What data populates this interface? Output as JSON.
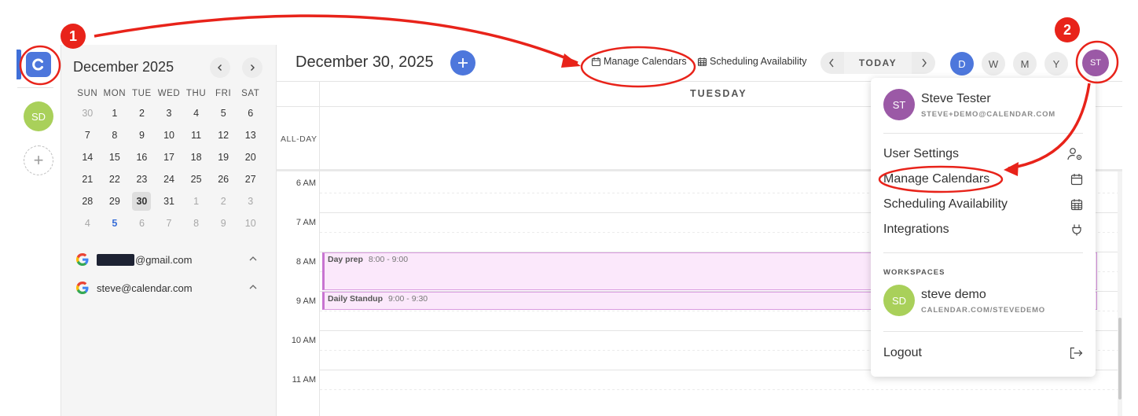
{
  "colors": {
    "accent": "#4d77dc",
    "annotation": "#e8231a",
    "event_bg": "#fbe8fb",
    "workspace_avatar": "#a9d05a",
    "user_avatar": "#9b59a6"
  },
  "rail": {
    "logo_icon": "calendar-logo-icon",
    "workspace_initials": "SD",
    "add_icon": "plus-icon"
  },
  "mini_calendar": {
    "month_label": "December 2025",
    "weekdays": [
      "SUN",
      "MON",
      "TUE",
      "WED",
      "THU",
      "FRI",
      "SAT"
    ],
    "weeks": [
      [
        "30",
        "1",
        "2",
        "3",
        "4",
        "5",
        "6"
      ],
      [
        "7",
        "8",
        "9",
        "10",
        "11",
        "12",
        "13"
      ],
      [
        "14",
        "15",
        "16",
        "17",
        "18",
        "19",
        "20"
      ],
      [
        "21",
        "22",
        "23",
        "24",
        "25",
        "26",
        "27"
      ],
      [
        "28",
        "29",
        "30",
        "31",
        "1",
        "2",
        "3"
      ],
      [
        "4",
        "5",
        "6",
        "7",
        "8",
        "9",
        "10"
      ]
    ]
  },
  "calendars": [
    {
      "label": "@gmail.com",
      "redacted_prefix": true
    },
    {
      "label": "steve@calendar.com",
      "redacted_prefix": false
    }
  ],
  "header": {
    "date_title": "December 30, 2025",
    "manage_calendars": "Manage Calendars",
    "scheduling_availability": "Scheduling Availability",
    "today": "TODAY",
    "views": [
      "D",
      "W",
      "M",
      "Y"
    ],
    "user_initials": "ST"
  },
  "day_view": {
    "weekday": "TUESDAY",
    "all_day_label": "ALL-DAY",
    "hours": [
      "6 AM",
      "7 AM",
      "8 AM",
      "9 AM",
      "10 AM",
      "11 AM"
    ],
    "events": [
      {
        "title": "Day prep",
        "time": "8:00 - 9:00"
      },
      {
        "title": "Daily Standup",
        "time": "9:00 - 9:30"
      }
    ]
  },
  "user_menu": {
    "user_initials": "ST",
    "user_name": "Steve Tester",
    "user_email": "STEVE+DEMO@CALENDAR.COM",
    "items": [
      {
        "label": "User Settings",
        "icon": "user-settings-icon"
      },
      {
        "label": "Manage Calendars",
        "icon": "calendar-icon"
      },
      {
        "label": "Scheduling Availability",
        "icon": "calendar-grid-icon"
      },
      {
        "label": "Integrations",
        "icon": "plug-icon"
      }
    ],
    "workspaces_label": "WORKSPACES",
    "workspace_initials": "SD",
    "workspace_name": "steve demo",
    "workspace_url": "CALENDAR.COM/STEVEDEMO",
    "logout": "Logout"
  },
  "annotations": {
    "step_1": "1",
    "step_2": "2"
  }
}
